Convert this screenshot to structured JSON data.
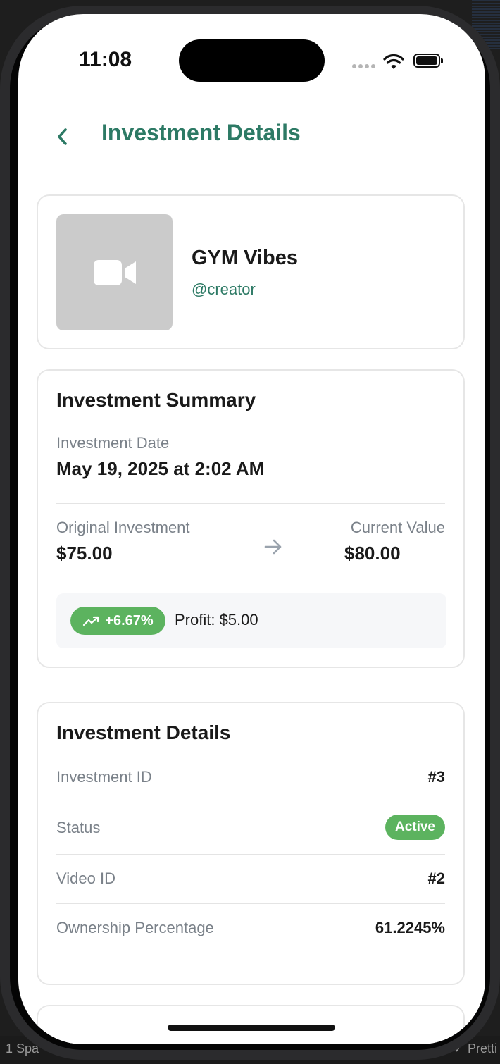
{
  "status_bar": {
    "time": "11:08"
  },
  "header": {
    "title": "Investment Details"
  },
  "video": {
    "title": "GYM Vibes",
    "creator": "@creator",
    "thumbnail_icon": "video-camera-icon"
  },
  "summary": {
    "title": "Investment Summary",
    "date_label": "Investment Date",
    "date_value": "May 19, 2025 at 2:02 AM",
    "original_label": "Original Investment",
    "original_value": "$75.00",
    "current_label": "Current Value",
    "current_value": "$80.00",
    "change_pct": "+6.67%",
    "profit_text": "Profit: $5.00",
    "trend_icon": "trending-up-icon"
  },
  "details": {
    "title": "Investment Details",
    "rows": [
      {
        "label": "Investment ID",
        "value": "#3"
      },
      {
        "label": "Status",
        "value": "Active"
      },
      {
        "label": "Video ID",
        "value": "#2"
      },
      {
        "label": "Ownership Percentage",
        "value": "61.2245%"
      }
    ]
  },
  "editor": {
    "left_text": "1   Spa",
    "right_text": "✓ Pretti"
  },
  "colors": {
    "accent": "#2d7a65",
    "success": "#5cb35f",
    "muted": "#7a8189"
  }
}
